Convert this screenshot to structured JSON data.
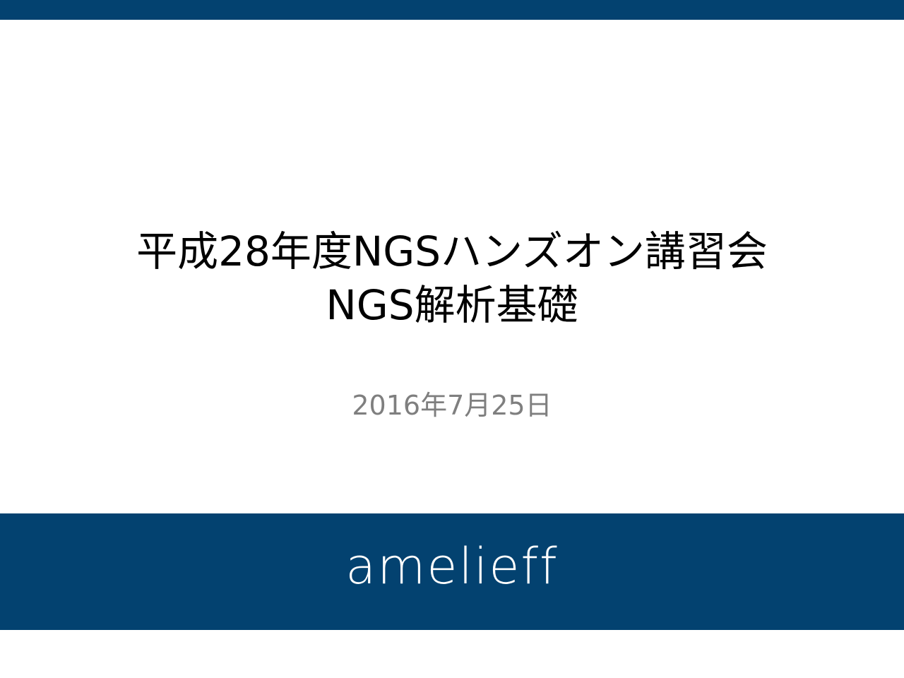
{
  "slide": {
    "title_line1": "平成28年度NGSハンズオン講習会",
    "title_line2": "NGS解析基礎",
    "date": "2016年7月25日",
    "logo_text": "amelieff"
  },
  "colors": {
    "brand_navy": "#034270",
    "date_gray": "#7f7f7f",
    "title_black": "#000000"
  }
}
